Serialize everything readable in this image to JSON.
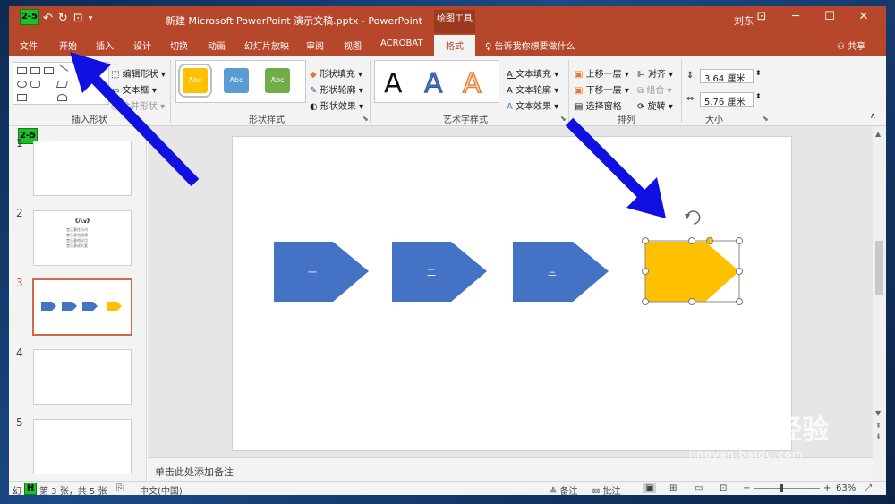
{
  "titlebar": {
    "title": "新建 Microsoft PowerPoint 演示文稿.pptx  -  PowerPoint",
    "context_tab": "绘图工具",
    "user": "刘东",
    "qat_marker": "2-5"
  },
  "tabs": [
    "文件",
    "开始",
    "插入",
    "设计",
    "切换",
    "动画",
    "幻灯片放映",
    "审阅",
    "视图",
    "ACROBAT",
    "格式"
  ],
  "active_tab": "格式",
  "tell_me": "告诉我你想要做什么",
  "share": "共享",
  "ribbon": {
    "insert_shapes": {
      "label": "插入形状",
      "edit_shape": "编辑形状",
      "text_box": "文本框",
      "merge_shapes": "合并形状"
    },
    "shape_styles": {
      "label": "形状样式",
      "fill": "形状填充",
      "outline": "形状轮廓",
      "effects": "形状效果",
      "sample": "Abc"
    },
    "wordart_styles": {
      "label": "艺术字样式",
      "text_fill": "文本填充",
      "text_outline": "文本轮廓",
      "text_effects": "文本效果",
      "letter": "A"
    },
    "arrange": {
      "label": "排列",
      "bring_forward": "上移一层",
      "send_backward": "下移一层",
      "selection_pane": "选择窗格",
      "align": "对齐",
      "group": "组合",
      "rotate": "旋转"
    },
    "size": {
      "label": "大小",
      "height": "3.64 厘米",
      "width": "5.76 厘米"
    }
  },
  "slides_panel": {
    "marker": "2-5",
    "numbers": [
      "1",
      "2",
      "3",
      "4",
      "5"
    ],
    "selected": "3",
    "slide2_title": "《八v》",
    "slide2_lines": [
      "昔正意往乐内",
      "昔乐意他清满",
      "昔乐意他好月",
      "昔乐意成大要"
    ]
  },
  "slide": {
    "pentagon_labels": [
      "一",
      "二",
      "三"
    ]
  },
  "notes_placeholder": "单击此处添加备注",
  "statusbar": {
    "slide_info_prefix": "幻",
    "marker": "H",
    "slide_info": "第 3 张，共 5 张",
    "language": "中文(中国)",
    "notes": "备注",
    "comments": "批注",
    "zoom": "63%"
  },
  "watermark": {
    "main": "Baidu经验",
    "sub": "jingyan.baidu.com"
  },
  "colors": {
    "titlebar": "#b7472a",
    "shape_blue": "#4472c4",
    "shape_yellow": "#ffc000",
    "arrow_blue": "#1010e0",
    "marker_green": "#1bbf2a"
  }
}
